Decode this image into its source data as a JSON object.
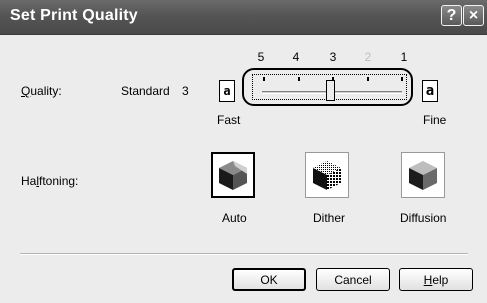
{
  "window": {
    "title": "Set Print Quality",
    "help_glyph": "?",
    "close_glyph": "×"
  },
  "quality": {
    "label_pre": "",
    "label_hotkey": "Q",
    "label_post": "uality:",
    "mode": "Standard",
    "level": "3",
    "scale": [
      "5",
      "4",
      "3",
      "2",
      "1"
    ],
    "scale_disabled": [
      false,
      false,
      false,
      true,
      false
    ],
    "fast_label": "Fast",
    "fine_label": "Fine",
    "fast_glyph": "a",
    "fine_glyph": "a",
    "value": 3
  },
  "halftoning": {
    "label_pre": "Ha",
    "label_hotkey": "l",
    "label_post": "ftoning:",
    "options": [
      {
        "label": "Auto",
        "selected": true
      },
      {
        "label": "Dither",
        "selected": false
      },
      {
        "label": "Diffusion",
        "selected": false
      }
    ]
  },
  "buttons": {
    "ok": "OK",
    "cancel": "Cancel",
    "help_pre": "",
    "help_hotkey": "H",
    "help_post": "elp"
  }
}
